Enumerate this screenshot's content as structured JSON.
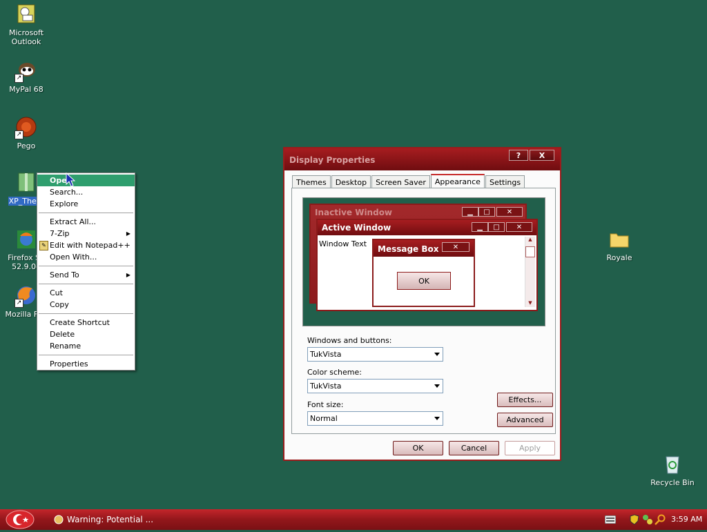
{
  "desktop": {
    "icons": [
      {
        "label": "Microsoft Outlook",
        "icon": "outlook-icon"
      },
      {
        "label": "MyPal 68",
        "icon": "mypal-icon"
      },
      {
        "label": "Pego",
        "icon": "pego-icon"
      },
      {
        "label": "XP_Them",
        "icon": "zip-folder-icon"
      },
      {
        "label": "Firefox Se\n52.9.0e",
        "icon": "firefox-setup-icon"
      },
      {
        "label": "Mozilla Fire",
        "icon": "firefox-icon"
      },
      {
        "label": "Royale",
        "icon": "folder-icon"
      },
      {
        "label": "Recycle Bin",
        "icon": "recycle-bin-icon"
      }
    ]
  },
  "context_menu": {
    "items": [
      {
        "label": "Open",
        "bold": true,
        "highlighted": true
      },
      {
        "label": "Search..."
      },
      {
        "label": "Explore"
      },
      {
        "label": "Extract All..."
      },
      {
        "label": "7-Zip",
        "submenu": true
      },
      {
        "label": "Edit with Notepad++",
        "icon": "notepad-plus-plus-icon"
      },
      {
        "label": "Open With..."
      },
      {
        "label": "Send To",
        "submenu": true
      },
      {
        "label": "Cut"
      },
      {
        "label": "Copy"
      },
      {
        "label": "Create Shortcut"
      },
      {
        "label": "Delete"
      },
      {
        "label": "Rename"
      },
      {
        "label": "Properties"
      }
    ]
  },
  "dialog": {
    "title": "Display Properties",
    "title_buttons": [
      "?",
      "X"
    ],
    "tabs": [
      "Themes",
      "Desktop",
      "Screen Saver",
      "Appearance",
      "Settings"
    ],
    "active_tab": "Appearance",
    "preview": {
      "inactive_title": "Inactive Window",
      "active_title": "Active Window",
      "window_text": "Window Text",
      "message_box_title": "Message Box",
      "message_box_ok": "OK"
    },
    "windows_and_buttons_label": "Windows and buttons:",
    "windows_and_buttons_value": "TukVista",
    "color_scheme_label": "Color scheme:",
    "color_scheme_value": "TukVista",
    "font_size_label": "Font size:",
    "font_size_value": "Normal",
    "effects_button": "Effects...",
    "advanced_button": "Advanced",
    "ok_button": "OK",
    "cancel_button": "Cancel",
    "apply_button": "Apply"
  },
  "taskbar": {
    "task_label": "Warning: Potential ...",
    "clock": "3:59 AM"
  },
  "colors": {
    "desktop_bg": "#215f4b",
    "accent_red": "#9b1c1c",
    "menu_highlight": "#2f9e6e"
  }
}
